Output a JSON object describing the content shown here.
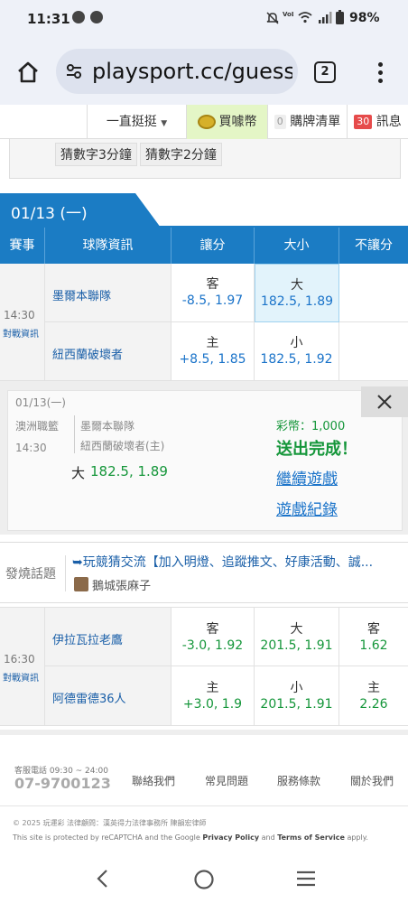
{
  "status": {
    "time": "11:31",
    "battery": "98%",
    "network_label": "VoLTE"
  },
  "browser": {
    "url": "playsport.cc/guess/",
    "tab_count": "2"
  },
  "sitenav": {
    "filter": "一直挺挺",
    "buy_coin": "買噱幣",
    "cart_count": "0",
    "cart_label": "購牌清單",
    "msg_count": "30",
    "msg_label": "訊息"
  },
  "game_tags": [
    "猜數字3分鐘",
    "猜數字2分鐘"
  ],
  "date_tab": "01/13 (一)",
  "table": {
    "headers": [
      "賽事",
      "球隊資訊",
      "讓分",
      "大小",
      "不讓分"
    ]
  },
  "match1": {
    "time": "14:30",
    "link": "對戰資訊",
    "teams": [
      "墨爾本聯隊",
      "紐西蘭破壞者"
    ],
    "spread": [
      {
        "side": "客",
        "value": "-8.5, 1.97"
      },
      {
        "side": "主",
        "value": "+8.5, 1.85"
      }
    ],
    "total": [
      {
        "side": "大",
        "value": "182.5, 1.89"
      },
      {
        "side": "小",
        "value": "182.5, 1.92"
      }
    ]
  },
  "popup": {
    "date": "01/13(一)",
    "league": "澳洲職籃",
    "time": "14:30",
    "team_away": "墨爾本聯隊",
    "team_home": "紐西蘭破壞者(主)",
    "pick_side": "大",
    "pick_value": "182.5, 1.89",
    "coin_label": "彩幣：1,000",
    "done": "送出完成！",
    "continue": "繼續遊戲",
    "record": "遊戲紀錄"
  },
  "hot_topic": {
    "label": "發燒話題",
    "title": "➥玩競猜交流【加入明燈、追蹤推文、好康活動、誠...",
    "author": "鵝城張麻子"
  },
  "match2": {
    "time": "16:30",
    "link": "對戰資訊",
    "teams": [
      "伊拉瓦拉老鷹",
      "阿德雷德36人"
    ],
    "spread": [
      {
        "side": "客",
        "value": "-3.0, 1.92"
      },
      {
        "side": "主",
        "value": "+3.0, 1.9"
      }
    ],
    "total": [
      {
        "side": "大",
        "value": "201.5, 1.91"
      },
      {
        "side": "小",
        "value": "201.5, 1.91"
      }
    ],
    "moneyline": [
      {
        "side": "客",
        "value": "1.62"
      },
      {
        "side": "主",
        "value": "2.26"
      }
    ]
  },
  "footer": {
    "service_label": "客服電話 09:30 ~ 24:00",
    "phone": "07-9700123",
    "links": [
      "聯絡我們",
      "常見問題",
      "服務條款",
      "關於我們"
    ],
    "copyright": "© 2025 玩運彩 法律顧問：漢英得力法律事務所 陳韻宏律師",
    "recaptcha_pre": "This site is protected by reCAPTCHA and the Google ",
    "privacy": "Privacy Policy",
    "and": " and ",
    "terms": "Terms of Service",
    "apply": " apply."
  },
  "colors": {
    "header_blue": "#1b7cc4",
    "odds_green": "#15963a",
    "selected_bg": "#e2f3fb"
  }
}
